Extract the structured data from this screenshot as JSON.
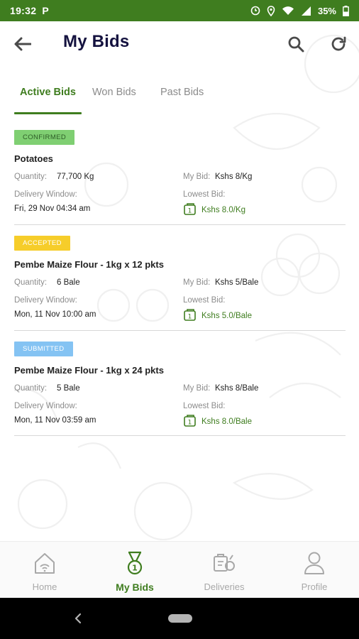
{
  "status_bar": {
    "time": "19:32",
    "battery": "35%"
  },
  "header": {
    "title": "My Bids"
  },
  "tabs": [
    {
      "label": "Active Bids",
      "active": true
    },
    {
      "label": "Won Bids",
      "active": false
    },
    {
      "label": "Past Bids",
      "active": false
    }
  ],
  "labels": {
    "quantity": "Quantity:",
    "my_bid": "My Bid:",
    "delivery_window": "Delivery Window:",
    "lowest_bid": "Lowest Bid:"
  },
  "bids": [
    {
      "status": "CONFIRMED",
      "product": "Potatoes",
      "quantity": "77,700 Kg",
      "my_bid": "Kshs 8/Kg",
      "delivery_window": "Fri, 29 Nov 04:34 am",
      "lowest_bid": "Kshs 8.0/Kg"
    },
    {
      "status": "ACCEPTED",
      "product": "Pembe Maize Flour - 1kg x 12 pkts",
      "quantity": "6 Bale",
      "my_bid": "Kshs 5/Bale",
      "delivery_window": "Mon, 11 Nov 10:00 am",
      "lowest_bid": "Kshs 5.0/Bale"
    },
    {
      "status": "SUBMITTED",
      "product": "Pembe Maize Flour - 1kg x 24 pkts",
      "quantity": "5 Bale",
      "my_bid": "Kshs 8/Bale",
      "delivery_window": "Mon, 11 Nov 03:59 am",
      "lowest_bid": "Kshs 8.0/Bale"
    }
  ],
  "bottom_nav": [
    {
      "label": "Home",
      "icon": "home-icon",
      "active": false
    },
    {
      "label": "My Bids",
      "icon": "medal-icon",
      "active": true
    },
    {
      "label": "Deliveries",
      "icon": "deliveries-icon",
      "active": false
    },
    {
      "label": "Profile",
      "icon": "profile-icon",
      "active": false
    }
  ],
  "colors": {
    "primary_green": "#3f7d1f",
    "title_navy": "#14123f",
    "confirmed": "#7fcf72",
    "accepted": "#f6cd2a",
    "submitted": "#84c3f3"
  }
}
